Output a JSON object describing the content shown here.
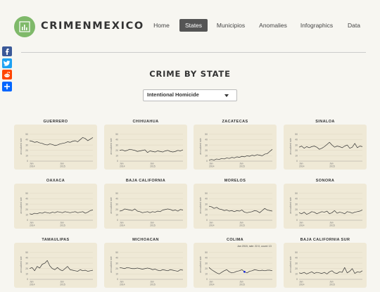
{
  "header": {
    "brand": "CRIMENMEXICO",
    "nav": [
      {
        "label": "Home",
        "active": false
      },
      {
        "label": "States",
        "active": true
      },
      {
        "label": "Municipios",
        "active": false
      },
      {
        "label": "Anomalies",
        "active": false
      },
      {
        "label": "Infographics",
        "active": false
      },
      {
        "label": "Data",
        "active": false
      }
    ]
  },
  "share_icons": [
    "facebook-icon",
    "twitter-icon",
    "reddit-icon",
    "add-share-icon"
  ],
  "colors": {
    "brand_green": "#7fb96a",
    "chart_bg": "#efe9d6",
    "line": "#333333",
    "facebook": "#3b5998",
    "twitter": "#1da1f2",
    "reddit": "#ff4500",
    "share_add": "#0166ff",
    "highlight_point": "#1a2be0"
  },
  "page_title": "CRIME BY STATE",
  "crime_select": {
    "value": "Intentional Homicide"
  },
  "chart_axis": {
    "ylabel": "annualized rate",
    "y_ticks": [
      "50",
      "40",
      "30",
      "20",
      "10",
      "0"
    ],
    "x_ticks": [
      {
        "month": "Jan",
        "year": "2014"
      },
      {
        "month": "Jan",
        "year": "2015"
      }
    ]
  },
  "chart_data": [
    {
      "type": "line",
      "title": "GUERRERO",
      "ylim": [
        0,
        55
      ],
      "values": [
        38,
        37,
        35,
        36,
        34,
        33,
        31,
        30,
        32,
        31,
        29,
        30,
        32,
        33,
        34,
        36,
        35,
        37,
        38,
        36,
        40,
        44,
        42,
        38,
        41,
        44
      ]
    },
    {
      "type": "line",
      "title": "CHIHUAHUA",
      "ylim": [
        0,
        55
      ],
      "values": [
        20,
        21,
        19,
        20,
        22,
        21,
        20,
        18,
        19,
        20,
        21,
        16,
        19,
        18,
        17,
        19,
        18,
        17,
        19,
        20,
        18,
        17,
        18,
        20,
        19,
        21
      ]
    },
    {
      "type": "line",
      "title": "ZACATECAS",
      "ylim": [
        0,
        55
      ],
      "values": [
        2,
        3,
        2,
        4,
        3,
        5,
        4,
        6,
        5,
        7,
        6,
        8,
        7,
        9,
        8,
        10,
        9,
        11,
        10,
        12,
        11,
        10,
        13,
        14,
        18,
        22
      ]
    },
    {
      "type": "line",
      "title": "SINALOA",
      "ylim": [
        0,
        55
      ],
      "values": [
        26,
        28,
        24,
        27,
        25,
        27,
        28,
        26,
        22,
        24,
        27,
        31,
        35,
        30,
        26,
        28,
        27,
        25,
        28,
        30,
        24,
        26,
        33,
        25,
        28,
        27
      ]
    },
    {
      "type": "line",
      "title": "OAXACA",
      "ylim": [
        0,
        55
      ],
      "values": [
        12,
        11,
        13,
        12,
        14,
        13,
        15,
        14,
        13,
        15,
        14,
        16,
        15,
        14,
        16,
        15,
        14,
        15,
        16,
        14,
        15,
        16,
        13,
        15,
        18,
        19
      ]
    },
    {
      "type": "line",
      "title": "BAJA CALIFORNIA",
      "ylim": [
        0,
        55
      ],
      "values": [
        17,
        18,
        21,
        20,
        19,
        18,
        21,
        17,
        16,
        14,
        15,
        16,
        14,
        16,
        15,
        17,
        16,
        19,
        20,
        21,
        20,
        18,
        19,
        17,
        20,
        19
      ]
    },
    {
      "type": "line",
      "title": "MORELOS",
      "ylim": [
        0,
        55
      ],
      "values": [
        26,
        25,
        22,
        24,
        21,
        20,
        18,
        19,
        17,
        18,
        16,
        18,
        17,
        19,
        15,
        14,
        15,
        16,
        18,
        17,
        14,
        18,
        22,
        19,
        18,
        17
      ]
    },
    {
      "type": "line",
      "title": "SONORA",
      "ylim": [
        0,
        55
      ],
      "values": [
        14,
        12,
        15,
        11,
        13,
        16,
        15,
        12,
        14,
        16,
        15,
        17,
        12,
        14,
        18,
        13,
        15,
        14,
        12,
        16,
        15,
        13,
        15,
        16,
        17,
        19
      ]
    },
    {
      "type": "line",
      "title": "TAMAULIPAS",
      "ylim": [
        0,
        55
      ],
      "values": [
        20,
        22,
        16,
        24,
        21,
        28,
        30,
        35,
        25,
        20,
        18,
        22,
        18,
        16,
        20,
        24,
        18,
        17,
        16,
        15,
        18,
        16,
        17,
        15,
        16,
        17
      ]
    },
    {
      "type": "line",
      "title": "MICHOACAN",
      "ylim": [
        0,
        55
      ],
      "values": [
        22,
        21,
        20,
        22,
        21,
        20,
        20,
        21,
        20,
        19,
        20,
        21,
        20,
        18,
        19,
        17,
        16,
        18,
        17,
        16,
        18,
        17,
        16,
        15,
        18,
        17
      ]
    },
    {
      "type": "line",
      "title": "COLIMA",
      "ylim": [
        0,
        55
      ],
      "values": [
        22,
        18,
        15,
        12,
        10,
        13,
        16,
        18,
        14,
        12,
        13,
        15,
        16,
        18,
        14,
        12,
        15,
        16,
        18,
        17,
        16,
        17,
        16,
        17,
        17,
        16
      ],
      "tooltip": "Jan 2015, rate: 22.0, count: 13",
      "highlight_index": 14
    },
    {
      "type": "line",
      "title": "BAJA CALIFORNIA SUR",
      "ylim": [
        0,
        55
      ],
      "values": [
        12,
        11,
        13,
        10,
        12,
        14,
        11,
        13,
        12,
        11,
        13,
        10,
        14,
        16,
        12,
        11,
        14,
        13,
        22,
        12,
        15,
        20,
        11,
        14,
        13,
        16
      ]
    }
  ]
}
